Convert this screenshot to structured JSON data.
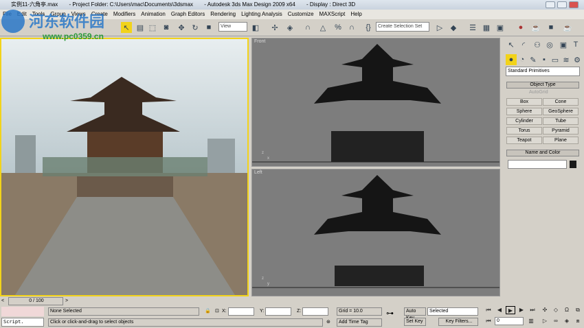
{
  "window": {
    "file": "实例11-六角亭.max",
    "project": "- Project Folder: C:\\Users\\mac\\Documents\\3dsmax",
    "app": "- Autodesk 3ds Max Design 2009 x64",
    "display": "- Display : Direct 3D"
  },
  "menu": [
    "File",
    "Edit",
    "Tools",
    "Group",
    "Views",
    "Create",
    "Modifiers",
    "Animation",
    "Graph Editors",
    "Rendering",
    "Lighting Analysis",
    "Customize",
    "MAXScript",
    "Help"
  ],
  "watermark": {
    "name": "河东软件园",
    "url": "www.pc0359.cn"
  },
  "toolbar": {
    "reference_coord": "View",
    "selection_set_placeholder": "Create Selection Set"
  },
  "viewports": {
    "front": "Front",
    "left": "Left"
  },
  "command_panel": {
    "category": "Standard Primitives",
    "object_type_title": "Object Type",
    "autogrid": "AutoGrid",
    "buttons": [
      "Box",
      "Cone",
      "Sphere",
      "GeoSphere",
      "Cylinder",
      "Tube",
      "Torus",
      "Pyramid",
      "Teapot",
      "Plane"
    ],
    "name_color_title": "Name and Color",
    "object_color": "#1a1a1a"
  },
  "timeline": {
    "frame": "0 / 100"
  },
  "status": {
    "script": "Script.",
    "selection": "None Selected",
    "x_label": "X:",
    "y_label": "Y:",
    "z_label": "Z:",
    "grid": "Grid = 10.0",
    "prompt": "Click or click-and-drag to select objects",
    "add_time_tag": "Add Time Tag"
  },
  "anim": {
    "auto_key": "Auto Key",
    "set_key": "Set Key",
    "key_mode": "Selected",
    "key_filters": "Key Filters...",
    "current_frame": "0"
  },
  "colors": {
    "active_viewport_border": "#f2d31a",
    "viewport_bg": "#7d7d7d"
  }
}
